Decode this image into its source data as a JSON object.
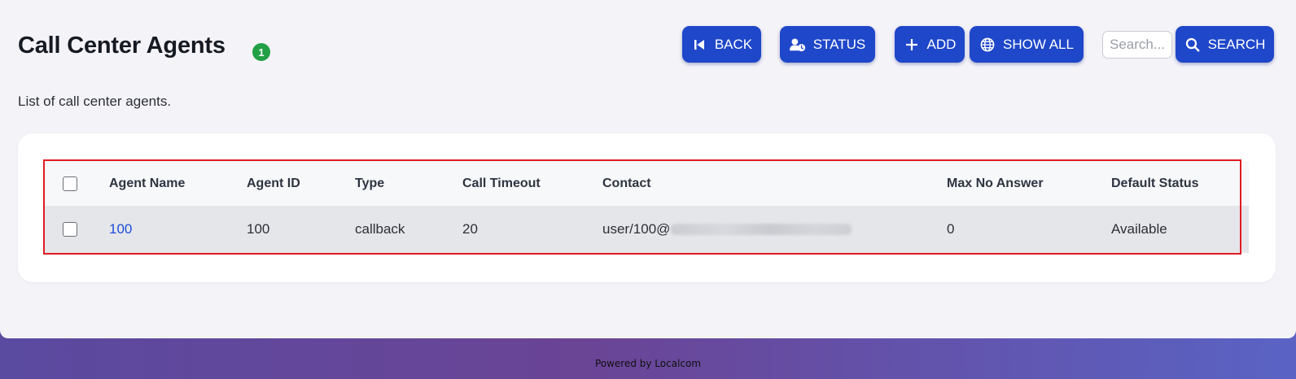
{
  "header": {
    "title": "Call Center Agents",
    "count_badge": "1",
    "subtitle": "List of call center agents."
  },
  "toolbar": {
    "back_label": "BACK",
    "status_label": "STATUS",
    "add_label": "ADD",
    "show_all_label": "SHOW ALL",
    "search_placeholder": "Search...",
    "search_value": "",
    "search_label": "SEARCH"
  },
  "table": {
    "columns": [
      "Agent Name",
      "Agent ID",
      "Type",
      "Call Timeout",
      "Contact",
      "Max No Answer",
      "Default Status"
    ],
    "rows": [
      {
        "agent_name": "100",
        "agent_id": "100",
        "type": "callback",
        "call_timeout": "20",
        "contact_visible": "user/100@",
        "max_no_answer": "0",
        "default_status": "Available"
      }
    ]
  },
  "footer": {
    "text": "Powered by Localcom"
  },
  "colors": {
    "accent": "#1f47c9",
    "badge": "#22a045",
    "link": "#1d4fd6",
    "highlight": "#e01b24"
  }
}
